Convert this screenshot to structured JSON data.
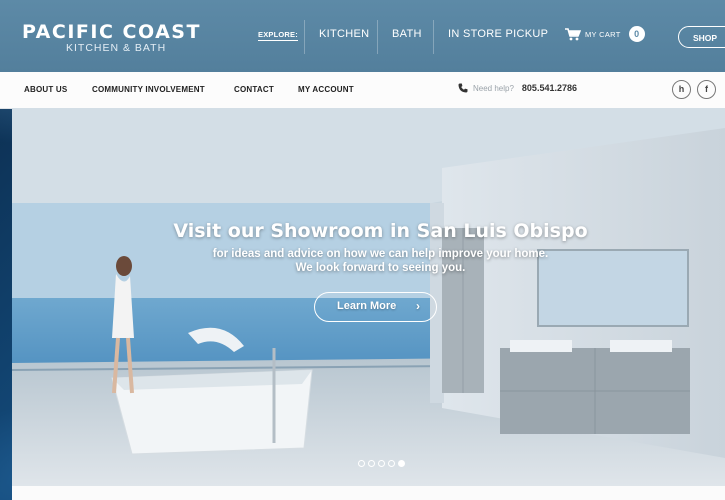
{
  "header": {
    "logo_main": "PACIFIC COAST",
    "logo_sub": "KITCHEN & BATH",
    "explore_label": "EXPLORE:",
    "nav": [
      {
        "label": "KITCHEN"
      },
      {
        "label": "BATH"
      },
      {
        "label": "IN STORE PICKUP"
      }
    ],
    "cart_label": "MY CART",
    "cart_count": "0",
    "shop_label": "SHOP",
    "accent_color": "#5d8aa7"
  },
  "subnav": {
    "items": [
      {
        "label": "ABOUT US"
      },
      {
        "label": "COMMUNITY INVOLVEMENT"
      },
      {
        "label": "CONTACT"
      },
      {
        "label": "MY ACCOUNT"
      }
    ],
    "help_label": "Need help?",
    "help_phone": "805.541.2786",
    "social": [
      {
        "icon": "houzz-icon",
        "glyph": "h"
      },
      {
        "icon": "facebook-icon",
        "glyph": "f"
      }
    ]
  },
  "hero": {
    "title": "Visit our Showroom in San Luis Obispo",
    "line1": "for ideas and advice on how we can help improve your home.",
    "line2": "We look forward to seeing you.",
    "button_label": "Learn More",
    "button_arrow": "›",
    "slides_total": 5,
    "active_slide": 5
  }
}
